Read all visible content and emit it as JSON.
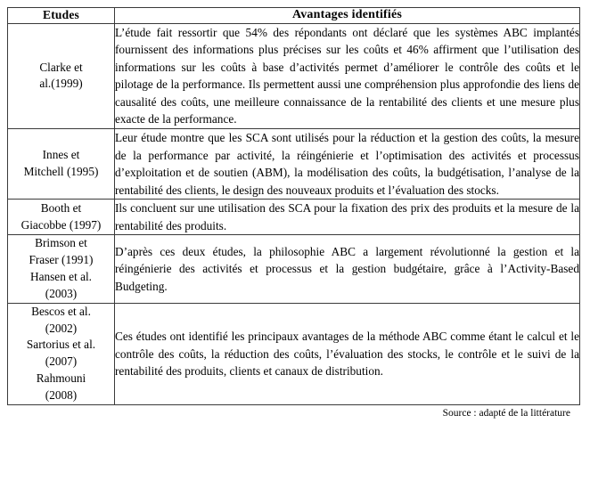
{
  "table": {
    "headers": {
      "studies": "Etudes",
      "advantages": "Avantages identifiés"
    },
    "rows": [
      {
        "study": "Clarke et\nal.(1999)",
        "advantage": "L’étude fait ressortir que 54% des répondants ont déclaré que les systèmes ABC implantés fournissent des informations plus précises sur les coûts et 46% affirment que l’utilisation des informations sur les coûts à base d’activités permet d’améliorer le contrôle des coûts et le pilotage de la performance. Ils permettent aussi une compréhension plus approfondie des liens de causalité des coûts, une meilleure connaissance de la rentabilité des clients et une mesure plus exacte de la performance."
      },
      {
        "study": "Innes et\nMitchell (1995)",
        "advantage": "Leur étude montre que les SCA sont utilisés pour la réduction et la gestion des coûts, la mesure de la performance par activité, la réingénierie et l’optimisation des activités et processus d’exploitation et de soutien (ABM), la modélisation des coûts, la budgétisation, l’analyse de la rentabilité des clients, le design des nouveaux produits et l’évaluation des stocks."
      },
      {
        "study": "Booth et\nGiacobbe (1997)",
        "advantage": "Ils concluent sur une utilisation des SCA pour la fixation des prix des produits et la mesure de la rentabilité des produits."
      },
      {
        "study": "Brimson et\nFraser (1991)\nHansen et al.\n(2003)",
        "advantage": "D’après ces deux études, la philosophie ABC a largement révolutionné la gestion et la réingénierie des activités et processus et la gestion budgétaire, grâce à l’Activity-Based Budgeting."
      },
      {
        "study": "Bescos et  al.\n(2002)\nSartorius et al.\n(2007)\nRahmouni\n(2008)",
        "advantage": "Ces études ont identifié les principaux avantages de la méthode ABC comme étant le calcul et le contrôle des coûts, la réduction des coûts, l’évaluation des stocks, le contrôle et le suivi de la rentabilité des produits, clients et canaux de distribution."
      }
    ]
  },
  "source": {
    "caption": "Source : adapté de la littérature"
  },
  "colors": {
    "border": "#3a3a3a",
    "text": "#000000",
    "background": "#ffffff"
  }
}
